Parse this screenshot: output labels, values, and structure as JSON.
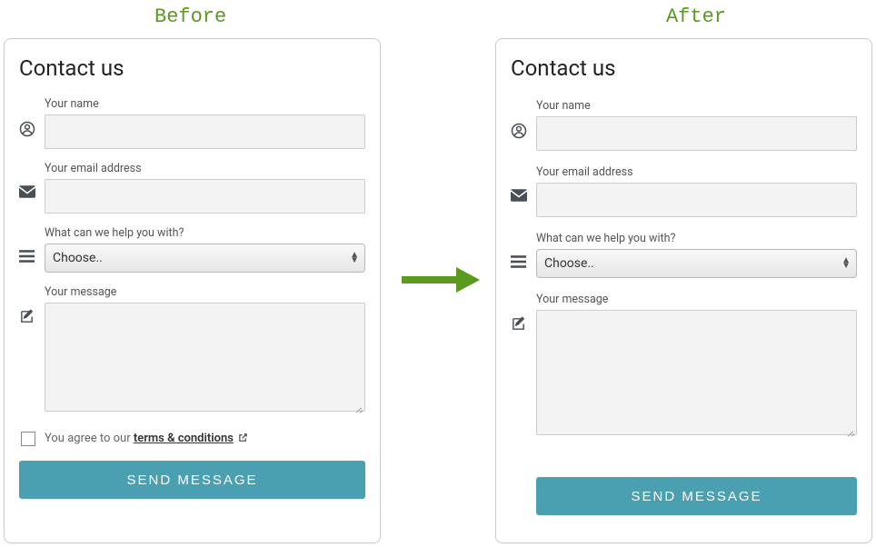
{
  "labels": {
    "before": "Before",
    "after": "After"
  },
  "card": {
    "title": "Contact us",
    "name_label": "Your name",
    "email_label": "Your email address",
    "help_label": "What can we help you with?",
    "help_selected": "Choose..",
    "message_label": "Your message",
    "terms_prefix": "You agree to our ",
    "terms_link": "terms & conditions",
    "send_button": "SEND MESSAGE"
  }
}
